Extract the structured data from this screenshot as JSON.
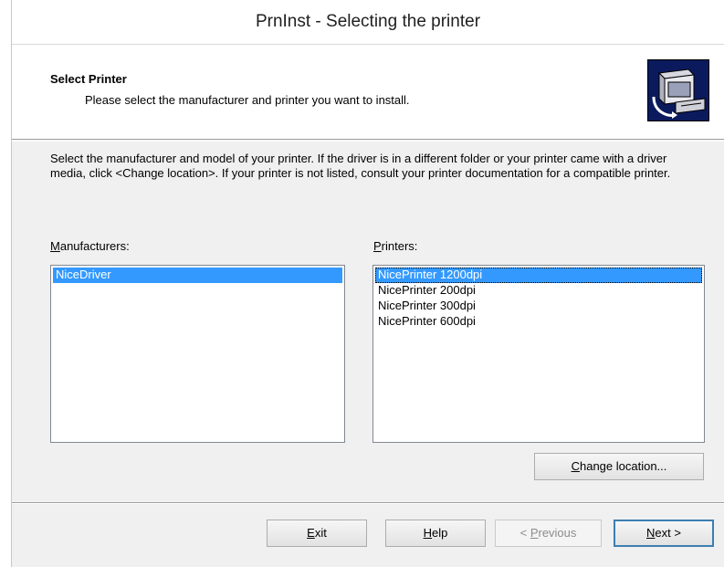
{
  "window": {
    "title": "PrnInst - Selecting the printer"
  },
  "header": {
    "title": "Select Printer",
    "subtitle": "Please select the manufacturer and printer you want to install.",
    "icon": "printer-install-icon"
  },
  "description": "Select the manufacturer and model of your printer. If the driver is in a different folder or your printer came with a driver media, click <Change location>. If your printer is not listed, consult your printer documentation for a compatible printer.",
  "manufacturers": {
    "label_accel": "M",
    "label_rest": "anufacturers:",
    "items": [
      "NiceDriver"
    ],
    "selected": "NiceDriver"
  },
  "printers": {
    "label_accel": "P",
    "label_rest": "rinters:",
    "items": [
      "NicePrinter 1200dpi",
      "NicePrinter 200dpi",
      "NicePrinter 300dpi",
      "NicePrinter 600dpi"
    ],
    "selected": "NicePrinter 1200dpi"
  },
  "buttons": {
    "change_accel": "C",
    "change_rest": "hange location...",
    "exit_accel": "E",
    "exit_rest": "xit",
    "help_accel": "H",
    "help_rest": "elp",
    "prev_pre": "< ",
    "prev_accel": "P",
    "prev_rest": "revious",
    "next_accel": "N",
    "next_rest": "ext >"
  },
  "colors": {
    "selection": "#3399ff",
    "header_icon_bg": "#0a1a5c",
    "default_button_border": "#3c7fb1"
  }
}
